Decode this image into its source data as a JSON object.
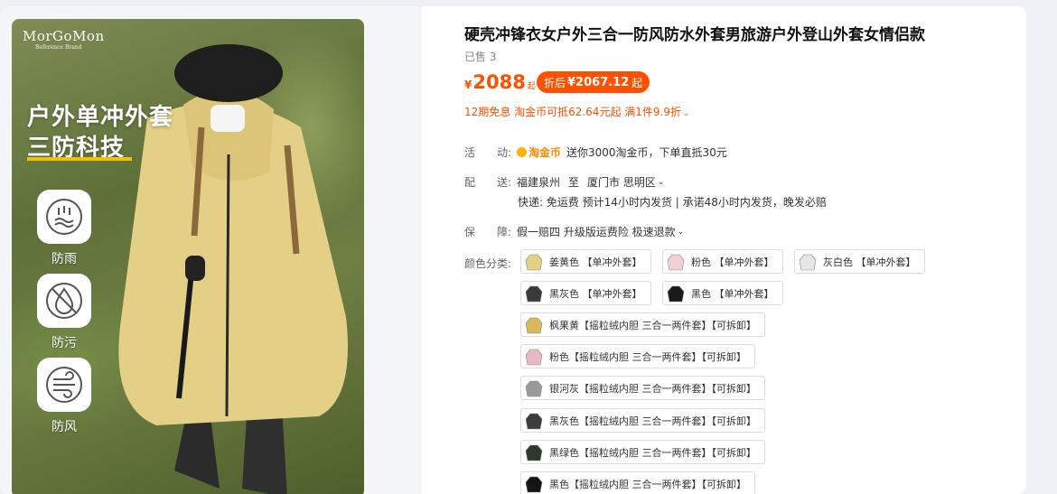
{
  "gallery": {
    "brand": "MorGoMon",
    "brand_sub": "Reference Brand",
    "title_line1": "户外单冲外套",
    "title_line2": "三防科技",
    "features": [
      {
        "label": "防雨",
        "icon": "rain-icon"
      },
      {
        "label": "防污",
        "icon": "stain-icon"
      },
      {
        "label": "防风",
        "icon": "wind-icon"
      }
    ]
  },
  "product": {
    "title": "硬壳冲锋衣女户外三合一防风防水外套男旅游户外登山外套女情侣款",
    "sold": "已售 3",
    "currency": "¥",
    "price": "2088",
    "price_suffix": "起",
    "after_discount_label": "折后",
    "after_discount_price": "¥2067.12",
    "after_discount_suffix": "起",
    "promo": "12期免息 淘金币可抵62.64元起 满1件9.9折",
    "accent_color": "#ff5000"
  },
  "details": {
    "activity_k1": "活",
    "activity_k2": "动:",
    "activity_badge": "淘金币",
    "activity_text": "送你3000淘金币，下单直抵30元",
    "shipping_k1": "配",
    "shipping_k2": "送:",
    "shipping_from": "福建泉州",
    "shipping_to_word": "至",
    "shipping_dest": "厦门市 思明区",
    "shipping_sub": "快递: 免运费  预计14小时内发货 | 承诺48小时内发货，晚发必赔",
    "guarantee_k1": "保",
    "guarantee_k2": "障:",
    "guarantee_text": "假一赔四 升级版运费险 极速退款"
  },
  "colors": {
    "label": "颜色分类:",
    "options": [
      {
        "label": "姜黄色 【单冲外套】",
        "color": "#e4cf86"
      },
      {
        "label": "粉色 【单冲外套】",
        "color": "#f1cfd4"
      },
      {
        "label": "灰白色 【单冲外套】",
        "color": "#e6e6e6"
      },
      {
        "label": "黑灰色 【单冲外套】",
        "color": "#3a3a3a"
      },
      {
        "label": "黑色 【单冲外套】",
        "color": "#1a1a1a"
      },
      {
        "label": "枫果黄【摇粒绒内胆 三合一两件套】【可拆卸】",
        "color": "#d8b85a"
      },
      {
        "label": "粉色【摇粒绒内胆 三合一两件套】【可拆卸】",
        "color": "#eab8c2"
      },
      {
        "label": "银河灰【摇粒绒内胆 三合一两件套】【可拆卸】",
        "color": "#9a9a9a"
      },
      {
        "label": "黑灰色【摇粒绒内胆 三合一两件套】【可拆卸】",
        "color": "#3d3d3d"
      },
      {
        "label": "黑绿色【摇粒绒内胆 三合一两件套】【可拆卸】",
        "color": "#2c3a2c"
      },
      {
        "label": "黑色【摇粒绒内胆 三合一两件套】【可拆卸】",
        "color": "#151515"
      }
    ]
  }
}
